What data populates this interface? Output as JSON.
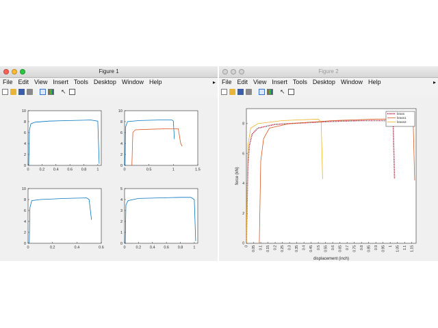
{
  "figure1": {
    "title": "Figure 1",
    "menu": [
      "File",
      "Edit",
      "View",
      "Insert",
      "Tools",
      "Desktop",
      "Window",
      "Help"
    ],
    "menu_more": "▸",
    "toolbar_icons": [
      "new-figure-icon",
      "open-folder-icon",
      "save-icon",
      "print-icon",
      "link-icon",
      "insert-colorbar-icon",
      "pointer-icon",
      "property-inspector-icon"
    ]
  },
  "figure2": {
    "title": "Figure 2",
    "menu": [
      "File",
      "Edit",
      "View",
      "Insert",
      "Tools",
      "Desktop",
      "Window",
      "Help"
    ],
    "menu_more": "▸",
    "toolbar_icons": [
      "new-figure-icon",
      "open-folder-icon",
      "save-icon",
      "print-icon",
      "link-icon",
      "insert-colorbar-icon",
      "pointer-icon",
      "property-inspector-icon"
    ]
  },
  "colors": {
    "blue": "#0072bd",
    "orange": "#d95319",
    "yellow": "#edb120",
    "brass_red": "#a2142f"
  },
  "chart_data": [
    {
      "type": "line",
      "ylim": [
        0,
        10
      ],
      "xlim": [
        0,
        1.05
      ],
      "xticks": [
        "0",
        "0.2",
        "0.4",
        "0.6",
        "0.8",
        "1"
      ],
      "yticks": [
        "0",
        "2",
        "4",
        "6",
        "8",
        "10"
      ],
      "series": [
        {
          "color": "blue",
          "points": [
            [
              0.01,
              0
            ],
            [
              0.02,
              6.5
            ],
            [
              0.04,
              7.6
            ],
            [
              0.1,
              7.9
            ],
            [
              0.3,
              8.1
            ],
            [
              0.6,
              8.2
            ],
            [
              0.9,
              8.3
            ],
            [
              1.0,
              8.1
            ],
            [
              1.02,
              0.3
            ]
          ]
        }
      ]
    },
    {
      "type": "line",
      "ylim": [
        0,
        10
      ],
      "xlim": [
        0,
        1.5
      ],
      "xticks": [
        "0",
        "0.5",
        "1",
        "1.5"
      ],
      "yticks": [
        "0",
        "2",
        "4",
        "6",
        "8",
        "10"
      ],
      "series": [
        {
          "color": "blue",
          "points": [
            [
              0.01,
              0
            ],
            [
              0.02,
              7.0
            ],
            [
              0.06,
              8.0
            ],
            [
              0.3,
              8.2
            ],
            [
              0.7,
              8.3
            ],
            [
              0.97,
              8.3
            ],
            [
              1.0,
              8.1
            ],
            [
              1.02,
              4.8
            ]
          ]
        },
        {
          "color": "orange",
          "points": [
            [
              0.15,
              0
            ],
            [
              0.17,
              6.0
            ],
            [
              0.22,
              6.5
            ],
            [
              0.5,
              6.6
            ],
            [
              0.9,
              6.7
            ],
            [
              1.1,
              6.7
            ],
            [
              1.15,
              4.0
            ],
            [
              1.18,
              3.5
            ]
          ]
        }
      ]
    },
    {
      "type": "line",
      "ylim": [
        0,
        10
      ],
      "xlim": [
        0,
        0.6
      ],
      "xticks": [
        "0",
        "0.2",
        "0.4",
        "0.6"
      ],
      "yticks": [
        "0",
        "2",
        "4",
        "6",
        "8",
        "10"
      ],
      "series": [
        {
          "color": "blue",
          "points": [
            [
              0.01,
              0
            ],
            [
              0.015,
              6.5
            ],
            [
              0.03,
              7.8
            ],
            [
              0.1,
              8.0
            ],
            [
              0.3,
              8.2
            ],
            [
              0.48,
              8.3
            ],
            [
              0.5,
              8.0
            ],
            [
              0.52,
              4.3
            ]
          ]
        }
      ]
    },
    {
      "type": "line",
      "ylim": [
        0,
        5
      ],
      "xlim": [
        0,
        1.05
      ],
      "xticks": [
        "0",
        "0.2",
        "0.4",
        "0.6",
        "0.8",
        "1"
      ],
      "yticks": [
        "0",
        "1",
        "2",
        "3",
        "4",
        "5"
      ],
      "series": [
        {
          "color": "blue",
          "points": [
            [
              0.01,
              0
            ],
            [
              0.02,
              3.5
            ],
            [
              0.05,
              3.9
            ],
            [
              0.2,
              4.1
            ],
            [
              0.5,
              4.15
            ],
            [
              0.8,
              4.2
            ],
            [
              0.95,
              4.2
            ],
            [
              1.0,
              4.0
            ],
            [
              1.02,
              0.2
            ]
          ]
        }
      ]
    },
    {
      "type": "line",
      "ylim": [
        0,
        9
      ],
      "xlim": [
        0,
        1.18
      ],
      "xlabel": "displacement (inch)",
      "ylabel": "force (kN)",
      "xticks": [
        "0",
        "0.05",
        "0.1",
        "0.15",
        "0.2",
        "0.25",
        "0.3",
        "0.35",
        "0.4",
        "0.45",
        "0.5",
        "0.55",
        "0.6",
        "0.65",
        "0.7",
        "0.75",
        "0.8",
        "0.85",
        "0.9",
        "0.95",
        "1",
        "1.05",
        "1.1",
        "1.15"
      ],
      "yticks": [
        "0",
        "2",
        "4",
        "6",
        "8"
      ],
      "legend": {
        "position": "top-right",
        "entries": [
          "brass",
          "brass1",
          "brass2"
        ]
      },
      "series": [
        {
          "name": "brass",
          "color": "brass_red",
          "dotted": true,
          "points": [
            [
              0,
              0
            ],
            [
              0.01,
              5.0
            ],
            [
              0.02,
              6.5
            ],
            [
              0.04,
              7.3
            ],
            [
              0.08,
              7.7
            ],
            [
              0.2,
              7.95
            ],
            [
              0.4,
              8.05
            ],
            [
              0.6,
              8.15
            ],
            [
              0.8,
              8.2
            ],
            [
              0.95,
              8.2
            ],
            [
              1.02,
              8.2
            ],
            [
              1.03,
              4.3
            ]
          ]
        },
        {
          "name": "brass1",
          "color": "orange",
          "points": [
            [
              0.09,
              0
            ],
            [
              0.1,
              5.5
            ],
            [
              0.12,
              7.0
            ],
            [
              0.16,
              7.7
            ],
            [
              0.3,
              8.0
            ],
            [
              0.6,
              8.2
            ],
            [
              0.9,
              8.3
            ],
            [
              1.15,
              8.3
            ],
            [
              1.16,
              8.0
            ],
            [
              1.17,
              4.2
            ]
          ]
        },
        {
          "name": "brass2",
          "color": "yellow",
          "points": [
            [
              0,
              0
            ],
            [
              0.01,
              6.5
            ],
            [
              0.03,
              7.7
            ],
            [
              0.08,
              8.0
            ],
            [
              0.25,
              8.2
            ],
            [
              0.5,
              8.3
            ],
            [
              0.52,
              8.1
            ],
            [
              0.53,
              4.3
            ]
          ]
        }
      ]
    }
  ]
}
